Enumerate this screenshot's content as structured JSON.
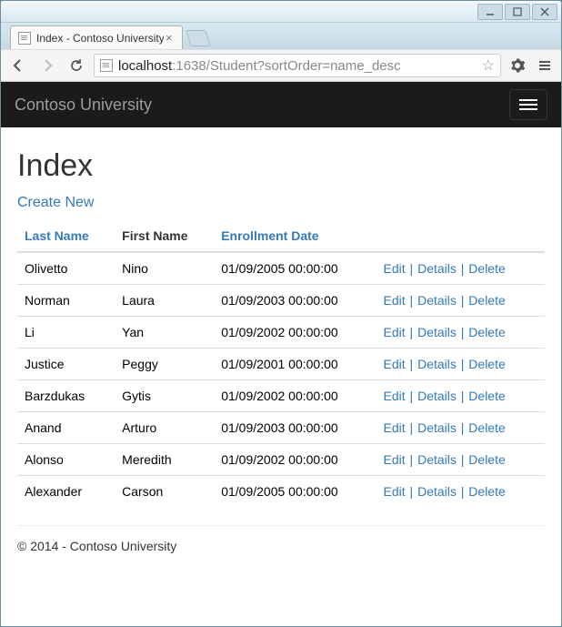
{
  "window": {
    "tab_title": "Index - Contoso University"
  },
  "addressbar": {
    "host": "localhost",
    "port": ":1638",
    "path": "/Student?sortOrder=name_desc"
  },
  "navbar": {
    "brand": "Contoso University"
  },
  "page": {
    "title": "Index",
    "create_link": "Create New"
  },
  "table": {
    "headers": {
      "last_name": "Last Name",
      "first_name": "First Name",
      "enrollment_date": "Enrollment Date"
    },
    "action_labels": {
      "edit": "Edit",
      "details": "Details",
      "delete": "Delete"
    },
    "rows": [
      {
        "last_name": "Olivetto",
        "first_name": "Nino",
        "enrollment_date": "01/09/2005 00:00:00"
      },
      {
        "last_name": "Norman",
        "first_name": "Laura",
        "enrollment_date": "01/09/2003 00:00:00"
      },
      {
        "last_name": "Li",
        "first_name": "Yan",
        "enrollment_date": "01/09/2002 00:00:00"
      },
      {
        "last_name": "Justice",
        "first_name": "Peggy",
        "enrollment_date": "01/09/2001 00:00:00"
      },
      {
        "last_name": "Barzdukas",
        "first_name": "Gytis",
        "enrollment_date": "01/09/2002 00:00:00"
      },
      {
        "last_name": "Anand",
        "first_name": "Arturo",
        "enrollment_date": "01/09/2003 00:00:00"
      },
      {
        "last_name": "Alonso",
        "first_name": "Meredith",
        "enrollment_date": "01/09/2002 00:00:00"
      },
      {
        "last_name": "Alexander",
        "first_name": "Carson",
        "enrollment_date": "01/09/2005 00:00:00"
      }
    ]
  },
  "footer": {
    "text": "© 2014 - Contoso University"
  }
}
